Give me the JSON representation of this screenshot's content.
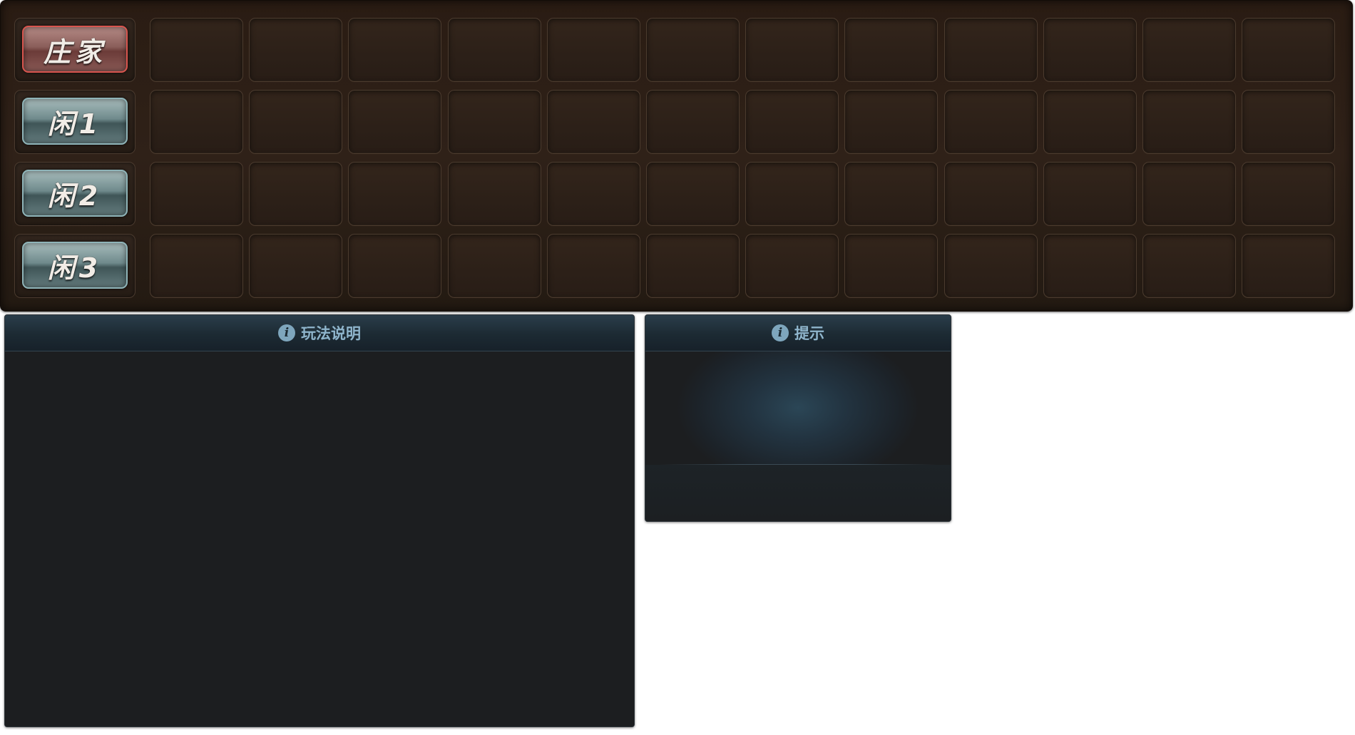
{
  "board": {
    "rows": [
      {
        "label": "庄家",
        "style": "red",
        "cells": 12
      },
      {
        "label": "闲1",
        "style": "teal",
        "cells": 12
      },
      {
        "label": "闲2",
        "style": "teal",
        "cells": 12
      },
      {
        "label": "闲3",
        "style": "teal",
        "cells": 12
      }
    ]
  },
  "rules_panel": {
    "icon": "info-icon",
    "icon_glyph": "i",
    "title": "玩法说明"
  },
  "tips_panel": {
    "icon": "info-icon",
    "icon_glyph": "i",
    "title": "提示"
  },
  "colors": {
    "banker_accent": "#d8554e",
    "player_accent": "#8fb4b8",
    "panel_title": "#8fb5cc",
    "board_bg": "#2f2118",
    "panel_bg": "#1c1e20"
  }
}
